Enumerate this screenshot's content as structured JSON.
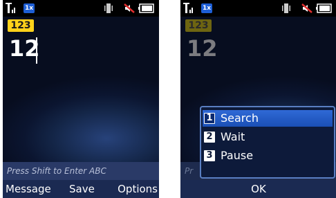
{
  "left_screen": {
    "mode_badge": "123",
    "typed_digits": "12",
    "hint_text": "Press Shift to Enter ABC",
    "softkeys": {
      "left": "Message",
      "center": "Save",
      "right": "Options"
    }
  },
  "right_screen": {
    "mode_badge": "123",
    "typed_digits": "12",
    "hint_text": "Pr",
    "menu": {
      "selected_index": 0,
      "items": [
        {
          "number": "1",
          "label": "Search"
        },
        {
          "number": "2",
          "label": "Wait"
        },
        {
          "number": "3",
          "label": "Pause"
        }
      ]
    },
    "softkeys": {
      "center": "OK"
    }
  },
  "status_icons": [
    "signal-strength-icon",
    "1x-network-icon",
    "vibrate-icon",
    "mute-icon",
    "battery-icon"
  ],
  "network_label": "1x",
  "colors": {
    "badge_yellow": "#ffd21a",
    "menu_highlight": "#2f69d6",
    "softkey_bar": "#1b2a52"
  }
}
